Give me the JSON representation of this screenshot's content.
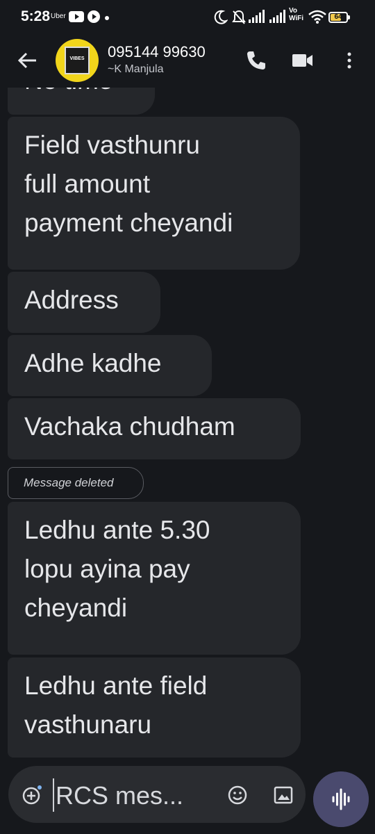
{
  "status_bar": {
    "time": "5:28",
    "uber_label": "Uber",
    "vo_top": "Vo",
    "vo_bottom": "WiFi",
    "battery": "64",
    "battery_level": 0.64
  },
  "header": {
    "contact_number": "095144 99630",
    "contact_name": "~K Manjula",
    "avatar_text": "VIBES"
  },
  "messages": [
    {
      "text": "No time"
    },
    {
      "text": "Field vasthunru\nfull amount\npayment cheyandi"
    },
    {
      "text": "Address"
    },
    {
      "text": "Adhe kadhe"
    },
    {
      "text": "Vachaka chudham"
    },
    {
      "deleted_label": "Message deleted"
    },
    {
      "text": "Ledhu ante 5.30\nlopu ayina pay\ncheyandi"
    },
    {
      "text": "Ledhu ante field\nvasthunaru"
    }
  ],
  "composer": {
    "placeholder": "RCS mes..."
  },
  "colors": {
    "background": "#16181c",
    "bubble": "#25272b",
    "composer": "#2a2c30",
    "voice_button": "#4a4a6e",
    "avatar": "#f1d51b"
  }
}
